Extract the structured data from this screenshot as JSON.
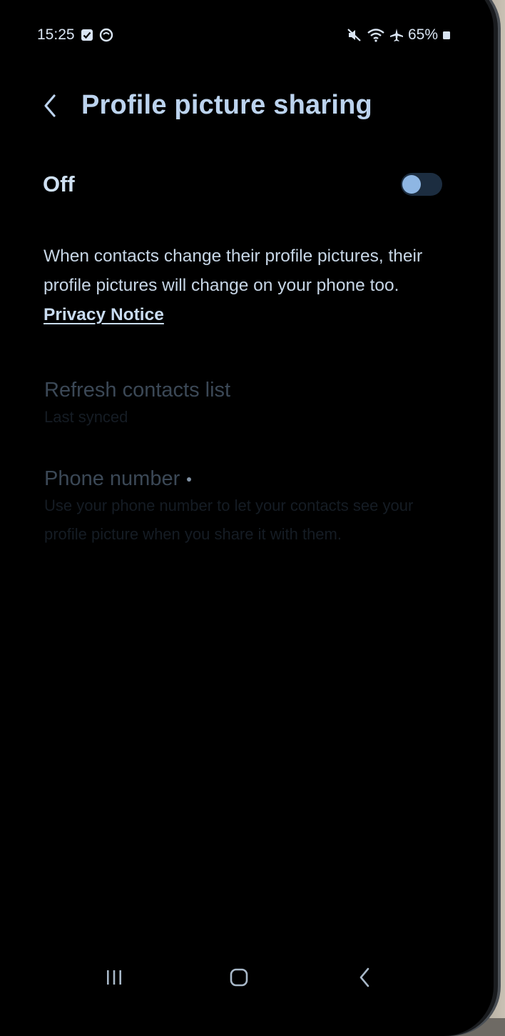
{
  "status_bar": {
    "time": "15:25",
    "battery": "65%",
    "icons": [
      "checkbox-notification-icon",
      "sync-circle-icon",
      "mute-icon",
      "wifi-icon",
      "airplane-mode-icon",
      "battery-icon"
    ]
  },
  "header": {
    "title": "Profile picture sharing",
    "back_icon": "chevron-left-icon"
  },
  "master_toggle": {
    "label": "Off",
    "state": "off"
  },
  "description": {
    "text": "When contacts change their profile pictures, their profile pictures will change on your phone too.",
    "link": "Privacy Notice"
  },
  "settings": [
    {
      "title": "Refresh contacts list",
      "subtitle": "Last synced",
      "enabled": false
    },
    {
      "title": "Phone number",
      "subtitle": "Use your phone number to let your contacts see your profile picture when you share it with them.",
      "enabled": false
    }
  ],
  "nav_bar": {
    "buttons": [
      "recents-icon",
      "home-icon",
      "back-icon"
    ]
  },
  "colors": {
    "accent": "#8eb6e3",
    "title": "#bcd3ee",
    "disabled_text": "#3b4856",
    "background": "#000000"
  }
}
